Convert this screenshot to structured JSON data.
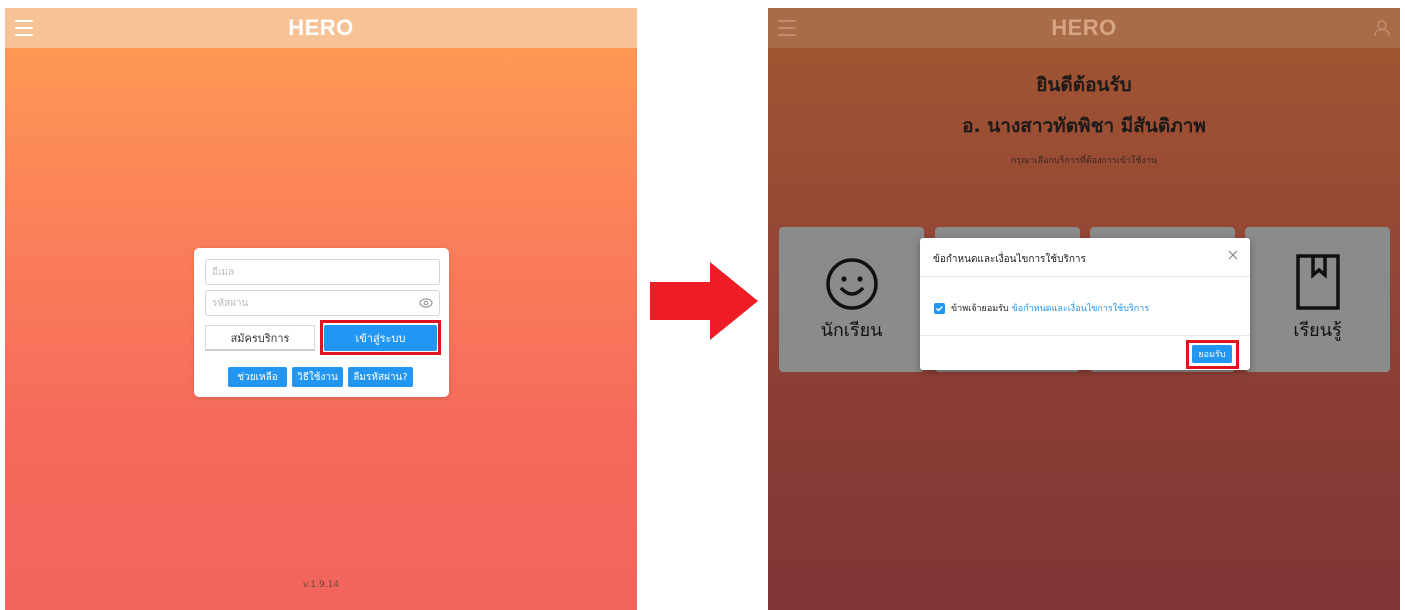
{
  "left_screen": {
    "header": {
      "title": "HERO",
      "menu_icon": "hamburger-icon"
    },
    "login": {
      "email_placeholder": "อีเมล",
      "password_placeholder": "รหัสผ่าน",
      "password_toggle_icon": "eye-icon",
      "register_label": "สมัครบริการ",
      "login_label": "เข้าสู่ระบบ",
      "help_label": "ช่วยเหลือ",
      "howto_label": "วิธีใช้งาน",
      "forgot_label": "ลืมรหัสผ่าน?"
    },
    "version": "v.1.9.14"
  },
  "right_screen": {
    "header": {
      "title": "HERO",
      "menu_icon": "hamburger-icon",
      "user_icon": "user-icon"
    },
    "welcome": {
      "line1": "ยินดีต้อนรับ",
      "line2": "อ. นางสาวทัตพิชา มีสันติภาพ",
      "subtitle": "กรุณาเลือกบริการที่ต้องการเข้าใช้งาน"
    },
    "service_cards": [
      {
        "label": "นักเรียน",
        "icon": "smiley-icon"
      },
      {
        "label": "เรียนรู้",
        "icon": "bookmark-icon"
      }
    ],
    "modal": {
      "title": "ข้อกำหนดและเงื่อนไขการใช้บริการ",
      "checkbox_checked": true,
      "agree_prefix": "ข้าพเจ้ายอมรับ",
      "agree_link": "ข้อกำหนดและเงื่อนไขการใช้บริการ",
      "accept_label": "ยอมรับ"
    }
  },
  "colors": {
    "accent_blue": "#2196f3",
    "highlight_red": "#e0141e",
    "arrow_red": "#ee1c24"
  }
}
